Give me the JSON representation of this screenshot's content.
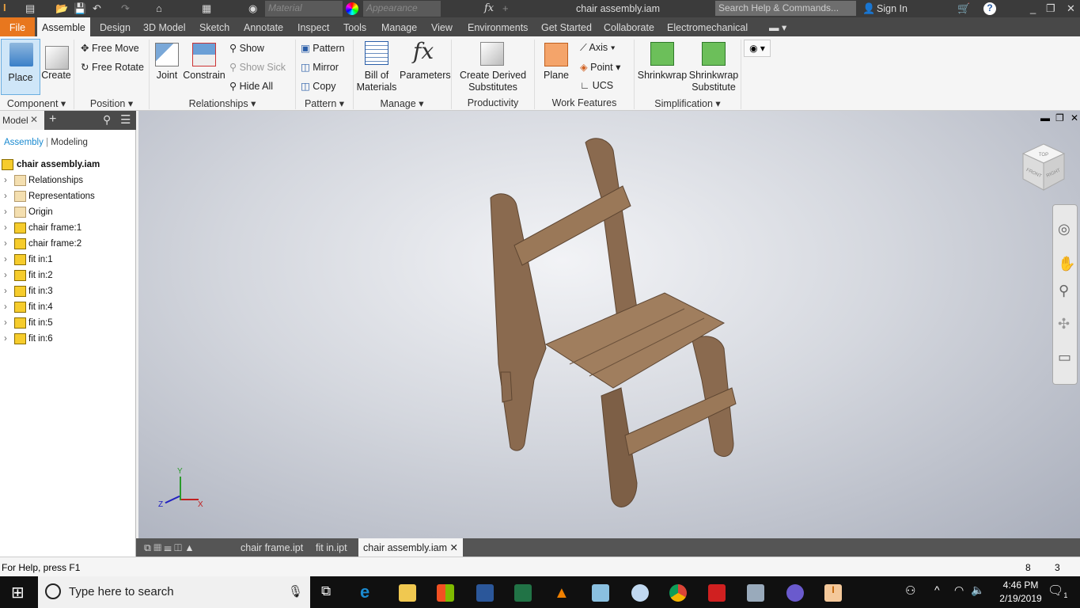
{
  "titlebar": {
    "title": "chair assembly.iam",
    "material_placeholder": "Material",
    "appearance_placeholder": "Appearance",
    "search_placeholder": "Search Help & Commands...",
    "sign_in": "Sign In"
  },
  "tabs": [
    "File",
    "Assemble",
    "Design",
    "3D Model",
    "Sketch",
    "Annotate",
    "Inspect",
    "Tools",
    "Manage",
    "View",
    "Environments",
    "Get Started",
    "Collaborate",
    "Electromechanical"
  ],
  "ribbon": {
    "component": {
      "label": "Component",
      "place": "Place",
      "create": "Create"
    },
    "position": {
      "label": "Position",
      "free_move": "Free Move",
      "free_rotate": "Free Rotate"
    },
    "relationships": {
      "label": "Relationships",
      "joint": "Joint",
      "constrain": "Constrain",
      "show": "Show",
      "show_sick": "Show Sick",
      "hide_all": "Hide All"
    },
    "pattern": {
      "label": "Pattern",
      "pattern": "Pattern",
      "mirror": "Mirror",
      "copy": "Copy"
    },
    "manage": {
      "label": "Manage",
      "bom_1": "Bill of",
      "bom_2": "Materials",
      "parameters": "Parameters"
    },
    "productivity": {
      "label": "Productivity",
      "derived_1": "Create Derived",
      "derived_2": "Substitutes"
    },
    "work_features": {
      "label": "Work Features",
      "plane": "Plane",
      "axis": "Axis",
      "point": "Point",
      "ucs": "UCS"
    },
    "simplification": {
      "label": "Simplification",
      "shrinkwrap": "Shrinkwrap",
      "sw_sub_1": "Shrinkwrap",
      "sw_sub_2": "Substitute"
    }
  },
  "browser": {
    "tab": "Model",
    "view_assembly": "Assembly",
    "view_modeling": "Modeling",
    "root": "chair assembly.iam",
    "items": [
      {
        "label": "Relationships",
        "type": "folder"
      },
      {
        "label": "Representations",
        "type": "folder"
      },
      {
        "label": "Origin",
        "type": "folder"
      },
      {
        "label": "chair frame:1",
        "type": "part"
      },
      {
        "label": "chair frame:2",
        "type": "part"
      },
      {
        "label": "fit in:1",
        "type": "part"
      },
      {
        "label": "fit in:2",
        "type": "part"
      },
      {
        "label": "fit in:3",
        "type": "part"
      },
      {
        "label": "fit in:4",
        "type": "part"
      },
      {
        "label": "fit in:5",
        "type": "part"
      },
      {
        "label": "fit in:6",
        "type": "part"
      }
    ]
  },
  "viewcube": {
    "top": "TOP",
    "front": "FRONT",
    "right": "RIGHT"
  },
  "axes": {
    "x": "X",
    "y": "Y",
    "z": "Z"
  },
  "doc_tabs": [
    "chair frame.ipt",
    "fit in.ipt",
    "chair assembly.iam"
  ],
  "status": {
    "help": "For Help, press F1",
    "count1": "8",
    "count2": "3"
  },
  "taskbar": {
    "search_placeholder": "Type here to search",
    "time": "4:46 PM",
    "date": "2/19/2019",
    "notifications": "1"
  },
  "colors": {
    "file_tab": "#e8771e",
    "wood": "#8a6a4f",
    "accent": "#1a8ad0"
  }
}
